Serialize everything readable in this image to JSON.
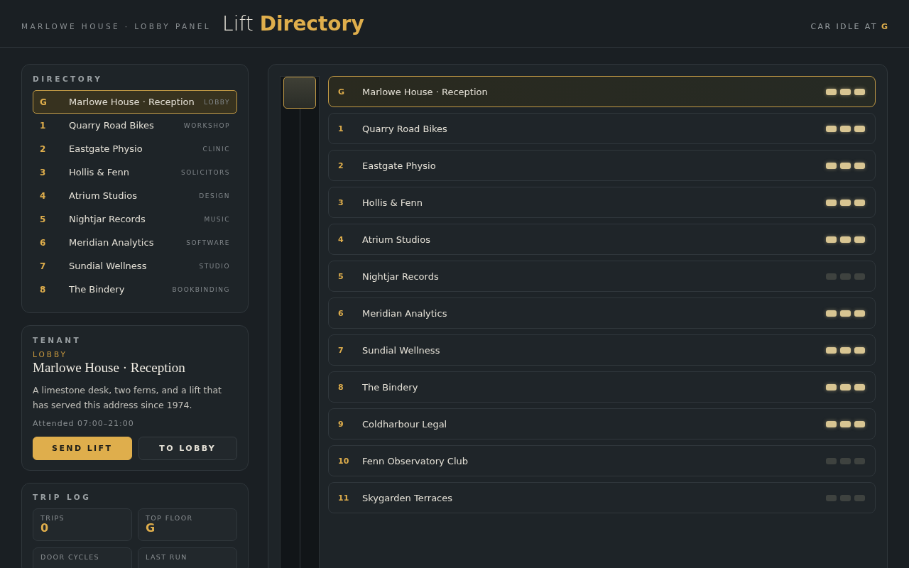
{
  "header": {
    "subtitle": "MARLOWE HOUSE · LOBBY PANEL",
    "title": "Lift **Directory**",
    "status": {
      "text": "CAR IDLE AT",
      "floor": "G"
    }
  },
  "directory": {
    "heading": "DIRECTORY",
    "items": [
      {
        "floor": "G",
        "name": "Marlowe House · Reception",
        "tag": "LOBBY",
        "selected": true
      },
      {
        "floor": "1",
        "name": "Quarry Road Bikes",
        "tag": "WORKSHOP",
        "selected": false
      },
      {
        "floor": "2",
        "name": "Eastgate Physio",
        "tag": "CLINIC",
        "selected": false
      },
      {
        "floor": "3",
        "name": "Hollis & Fenn",
        "tag": "SOLICITORS",
        "selected": false
      },
      {
        "floor": "4",
        "name": "Atrium Studios",
        "tag": "DESIGN",
        "selected": false
      },
      {
        "floor": "5",
        "name": "Nightjar Records",
        "tag": "MUSIC",
        "selected": false
      },
      {
        "floor": "6",
        "name": "Meridian Analytics",
        "tag": "SOFTWARE",
        "selected": false
      },
      {
        "floor": "7",
        "name": "Sundial Wellness",
        "tag": "STUDIO",
        "selected": false
      },
      {
        "floor": "8",
        "name": "The Bindery",
        "tag": "BOOKBINDING",
        "selected": false
      }
    ]
  },
  "tenant": {
    "heading": "TENANT",
    "tag": "LOBBY",
    "name": "Marlowe House · Reception",
    "description": "A limestone desk, two ferns, and a lift that has served this address since 1974.",
    "hours": "Attended 07:00–21:00",
    "buttons": [
      {
        "label": "SEND LIFT",
        "kind": "primary"
      },
      {
        "label": "TO LOBBY",
        "kind": "secondary"
      }
    ]
  },
  "trip_log": {
    "heading": "TRIP LOG",
    "stats": [
      {
        "label": "TRIPS",
        "value": "0"
      },
      {
        "label": "TOP FLOOR",
        "value": "G"
      },
      {
        "label": "DOOR CYCLES"
      },
      {
        "label": "LAST RUN"
      }
    ]
  },
  "floors": [
    {
      "floor": "G",
      "name": "Marlowe House · Reception",
      "selected": true,
      "lit": true
    },
    {
      "floor": "1",
      "name": "Quarry Road Bikes",
      "selected": false,
      "lit": true
    },
    {
      "floor": "2",
      "name": "Eastgate Physio",
      "selected": false,
      "lit": true
    },
    {
      "floor": "3",
      "name": "Hollis & Fenn",
      "selected": false,
      "lit": true
    },
    {
      "floor": "4",
      "name": "Atrium Studios",
      "selected": false,
      "lit": true
    },
    {
      "floor": "5",
      "name": "Nightjar Records",
      "selected": false,
      "lit": false
    },
    {
      "floor": "6",
      "name": "Meridian Analytics",
      "selected": false,
      "lit": true
    },
    {
      "floor": "7",
      "name": "Sundial Wellness",
      "selected": false,
      "lit": true
    },
    {
      "floor": "8",
      "name": "The Bindery",
      "selected": false,
      "lit": true
    },
    {
      "floor": "9",
      "name": "Coldharbour Legal",
      "selected": false,
      "lit": true
    },
    {
      "floor": "10",
      "name": "Fenn Observatory Club",
      "selected": false,
      "lit": false
    },
    {
      "floor": "11",
      "name": "Skygarden Terraces",
      "selected": false,
      "lit": false
    }
  ]
}
